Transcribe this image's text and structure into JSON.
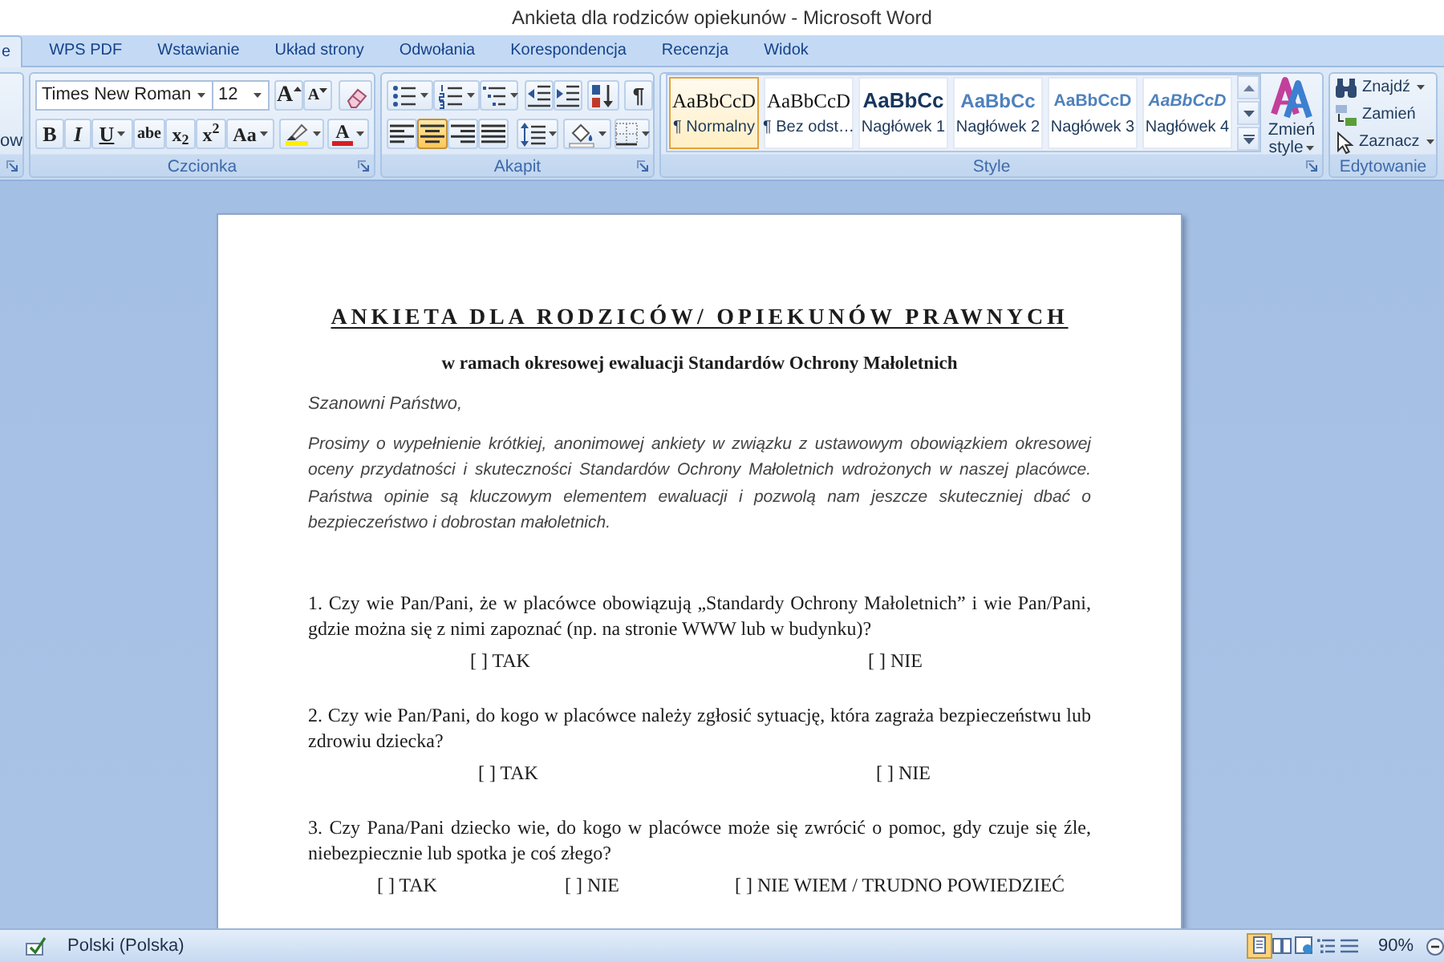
{
  "window": {
    "title": "Ankieta dla rodziców opiekunów - Microsoft Word"
  },
  "tabs": [
    {
      "label": "e",
      "selected": true
    },
    {
      "label": "WPS PDF",
      "selected": false
    },
    {
      "label": "Wstawianie",
      "selected": false
    },
    {
      "label": "Układ strony",
      "selected": false
    },
    {
      "label": "Odwołania",
      "selected": false
    },
    {
      "label": "Korespondencja",
      "selected": false
    },
    {
      "label": "Recenzja",
      "selected": false
    },
    {
      "label": "Widok",
      "selected": false
    }
  ],
  "ribbon": {
    "clipboard_group": {
      "visible_text": "ow"
    },
    "font_group": {
      "label": "Czcionka",
      "font_name": "Times New Roman",
      "font_size": "12",
      "size_buttons": [
        {
          "kind": "grow",
          "glyph": "A"
        },
        {
          "kind": "shrink",
          "glyph": "A"
        },
        {
          "kind": "clear"
        }
      ],
      "format_buttons": [
        {
          "kind": "bold",
          "glyph": "B",
          "dropdown": false
        },
        {
          "kind": "italic",
          "glyph": "I",
          "dropdown": false
        },
        {
          "kind": "underline",
          "glyph": "U",
          "dropdown": true
        },
        {
          "kind": "strike",
          "glyph": "abe",
          "dropdown": false
        },
        {
          "kind": "subscript",
          "glyph": "x$_{2}$",
          "dropdown": false
        },
        {
          "kind": "superscript",
          "glyph": "x$^{2}$",
          "dropdown": false
        },
        {
          "kind": "case",
          "glyph": "Aa",
          "dropdown": true
        },
        {
          "kind": "highlight",
          "dropdown": true
        },
        {
          "kind": "color",
          "glyph": "A",
          "dropdown": true
        }
      ]
    },
    "paragraph_group": {
      "label": "Akapit",
      "top_buttons": [
        {
          "kind": "bullets",
          "dropdown": true
        },
        {
          "kind": "numbering",
          "dropdown": true
        },
        {
          "kind": "multilevel",
          "dropdown": true
        },
        {
          "kind": "outdent",
          "dropdown": false
        },
        {
          "kind": "indent",
          "dropdown": false
        },
        {
          "kind": "sort",
          "dropdown": false
        },
        {
          "kind": "marks",
          "glyph": "¶",
          "dropdown": false
        }
      ],
      "align_buttons": [
        {
          "kind": "left",
          "selected": false
        },
        {
          "kind": "center",
          "selected": true
        },
        {
          "kind": "right",
          "selected": false
        },
        {
          "kind": "justify",
          "selected": false
        }
      ],
      "bottom_buttons": [
        {
          "kind": "spacing",
          "dropdown": true
        },
        {
          "kind": "shading",
          "dropdown": true
        },
        {
          "kind": "borders",
          "dropdown": true
        }
      ]
    },
    "style_group": {
      "label": "Style",
      "styles": [
        {
          "kind": "body",
          "preview": "AaBbCcD",
          "name": "¶ Normalny",
          "selected": true
        },
        {
          "kind": "body",
          "preview": "AaBbCcD",
          "name": "¶ Bez odst…",
          "selected": false
        },
        {
          "kind": "heading1",
          "preview": "AaBbCc",
          "name": "Nagłówek 1",
          "selected": false
        },
        {
          "kind": "heading2",
          "preview": "AaBbCc",
          "name": "Nagłówek 2",
          "selected": false
        },
        {
          "kind": "heading3",
          "preview": "AaBbCcD",
          "name": "Nagłówek 3",
          "selected": false
        },
        {
          "kind": "heading4",
          "preview": "AaBbCcD",
          "name": "Nagłówek 4",
          "selected": false
        }
      ],
      "change_styles": {
        "label": "Zmień style"
      }
    },
    "edit_group": {
      "label": "Edytowanie",
      "items": [
        {
          "kind": "find",
          "label": "Znajdź",
          "dropdown": true
        },
        {
          "kind": "replace",
          "label": "Zamień",
          "dropdown": false
        },
        {
          "kind": "select",
          "label": "Zaznacz",
          "dropdown": true
        }
      ]
    }
  },
  "document": {
    "title": "ANKIETA DLA RODZICÓW/ OPIEKUNÓW PRAWNYCH",
    "subtitle": "w ramach okresowej ewaluacji Standardów Ochrony Małoletnich",
    "greeting": "Szanowni Państwo,",
    "intro": "Prosimy o wypełnienie krótkiej, anonimowej ankiety w związku z ustawowym obowiązkiem okresowej oceny przydatności i skuteczności Standardów Ochrony Małoletnich wdrożonych w naszej placówce. Państwa opinie są kluczowym elementem ewaluacji i pozwolą nam jeszcze skuteczniej dbać o bezpieczeństwo i dobrostan małoletnich.",
    "questions": [
      {
        "text": "1. Czy wie Pan/Pani, że w placówce obowiązują „Standardy Ochrony Małoletnich” i wie Pan/Pani, gdzie można się z nimi zapoznać (np. na stronie WWW lub w budynku)?",
        "options": [
          "[ ] TAK",
          "[ ] NIE"
        ]
      },
      {
        "text": "2. Czy wie Pan/Pani, do kogo w placówce należy zgłosić sytuację, która zagraża bezpieczeństwu lub zdrowiu dziecka?",
        "options": [
          "[ ] TAK",
          "[ ] NIE"
        ]
      },
      {
        "text": "3. Czy Pana/Pani dziecko wie, do kogo w placówce może się zwrócić o pomoc, gdy czuje się źle, niebezpiecznie lub spotka je coś złego?",
        "options": [
          "[ ] TAK",
          "[ ] NIE",
          "[ ] NIE WIEM / TRUDNO POWIEDZIEĆ"
        ]
      }
    ]
  },
  "status_bar": {
    "language": "Polski (Polska)",
    "views": [
      {
        "kind": "print",
        "selected": true
      },
      {
        "kind": "reading",
        "selected": false
      },
      {
        "kind": "web",
        "selected": false
      },
      {
        "kind": "outline",
        "selected": false
      },
      {
        "kind": "draft",
        "selected": false
      }
    ],
    "zoom": "90%"
  }
}
